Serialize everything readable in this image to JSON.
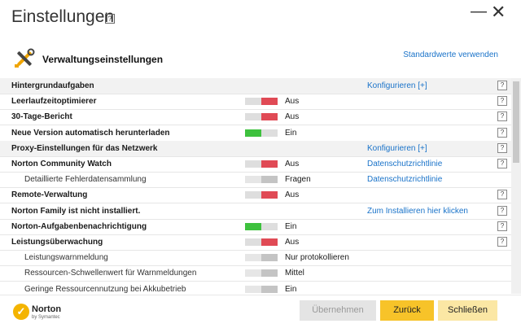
{
  "window": {
    "title": "Einstellungen",
    "help_label": "?",
    "minimize_label": "—",
    "close_label": "✕"
  },
  "section": {
    "title": "Verwaltungseinstellungen",
    "defaults_link": "Standardwerte verwenden"
  },
  "rows": [
    {
      "label": "Hintergrundaufgaben",
      "level": "main",
      "shaded": true,
      "toggle": null,
      "status": "",
      "link": "Konfigurieren [+]",
      "help": "?"
    },
    {
      "label": "Leerlaufzeitoptimierer",
      "level": "main",
      "shaded": false,
      "toggle": "off",
      "status": "Aus",
      "link": "",
      "help": "?"
    },
    {
      "label": "30-Tage-Bericht",
      "level": "main",
      "shaded": false,
      "toggle": "off",
      "status": "Aus",
      "link": "",
      "help": "?"
    },
    {
      "label": "Neue Version automatisch herunterladen",
      "level": "main",
      "shaded": false,
      "toggle": "on",
      "status": "Ein",
      "link": "",
      "help": "?"
    },
    {
      "label": "Proxy-Einstellungen für das Netzwerk",
      "level": "main",
      "shaded": true,
      "toggle": null,
      "status": "",
      "link": "Konfigurieren [+]",
      "help": "?"
    },
    {
      "label": "Norton Community Watch",
      "level": "main",
      "shaded": false,
      "toggle": "off",
      "status": "Aus",
      "link": "Datenschutzrichtlinie",
      "help": "?"
    },
    {
      "label": "Detaillierte Fehlerdatensammlung",
      "level": "sub",
      "shaded": false,
      "toggle": "grey",
      "status": "Fragen",
      "link": "Datenschutzrichtlinie",
      "help": ""
    },
    {
      "label": "Remote-Verwaltung",
      "level": "main",
      "shaded": false,
      "toggle": "off",
      "status": "Aus",
      "link": "",
      "help": "?"
    },
    {
      "label": "Norton Family ist nicht installiert.",
      "level": "main",
      "shaded": false,
      "toggle": null,
      "status": "",
      "link": "Zum Installieren hier klicken",
      "help": "?"
    },
    {
      "label": "Norton-Aufgabenbenachrichtigung",
      "level": "main",
      "shaded": false,
      "toggle": "on",
      "status": "Ein",
      "link": "",
      "help": "?"
    },
    {
      "label": "Leistungsüberwachung",
      "level": "main",
      "shaded": false,
      "toggle": "off",
      "status": "Aus",
      "link": "",
      "help": "?"
    },
    {
      "label": "Leistungswarnmeldung",
      "level": "sub",
      "shaded": false,
      "toggle": "grey",
      "status": "Nur protokollieren",
      "link": "",
      "help": ""
    },
    {
      "label": "Ressourcen-Schwellenwert für Warnmeldungen",
      "level": "sub",
      "shaded": false,
      "toggle": "grey",
      "status": "Mittel",
      "link": "",
      "help": ""
    },
    {
      "label": "Geringe Ressourcennutzung bei Akkubetrieb",
      "level": "sub",
      "shaded": false,
      "toggle": "grey",
      "status": "Ein",
      "link": "",
      "help": ""
    }
  ],
  "footer": {
    "logo_name": "Norton",
    "logo_sub": "by Symantec",
    "apply_label": "Übernehmen",
    "back_label": "Zurück",
    "close_label": "Schließen"
  },
  "colors": {
    "link": "#1a73c9",
    "toggle_on": "#3ec13e",
    "toggle_off": "#e04a55",
    "primary_button": "#f7c329",
    "secondary_button": "#fbe7a4",
    "disabled_button": "#e4e4e4"
  },
  "icons": {
    "section": "tools-icon",
    "brand": "norton-checkmark-icon"
  }
}
